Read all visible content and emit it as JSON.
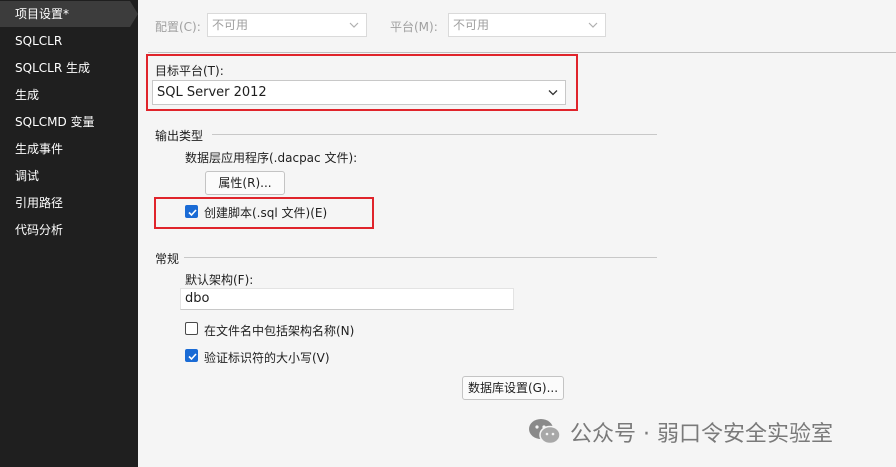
{
  "sidebar": {
    "items": [
      {
        "label": "项目设置*",
        "active": true
      },
      {
        "label": "SQLCLR"
      },
      {
        "label": "SQLCLR 生成"
      },
      {
        "label": "生成"
      },
      {
        "label": "SQLCMD 变量"
      },
      {
        "label": "生成事件"
      },
      {
        "label": "调试"
      },
      {
        "label": "引用路径"
      },
      {
        "label": "代码分析"
      }
    ]
  },
  "top": {
    "config_label": "配置(C):",
    "config_value": "不可用",
    "platform_label": "平台(M):",
    "platform_value": "不可用"
  },
  "target": {
    "label": "目标平台(T):",
    "value": "SQL Server 2012"
  },
  "output": {
    "section": "输出类型",
    "dacpac_label": "数据层应用程序(.dacpac 文件):",
    "properties_button": "属性(R)...",
    "create_script_label": "创建脚本(.sql 文件)(E)",
    "create_script_checked": true
  },
  "general": {
    "section": "常规",
    "schema_label": "默认架构(F):",
    "schema_value": "dbo",
    "include_schema_label": "在文件名中包括架构名称(N)",
    "include_schema_checked": false,
    "validate_case_label": "验证标识符的大小写(V)",
    "validate_case_checked": true,
    "db_settings_button": "数据库设置(G)..."
  },
  "watermark": {
    "text": "公众号 · 弱口令安全实验室"
  },
  "colors": {
    "sidebar_bg": "#1f1f1f",
    "sidebar_active": "#3c3c3c",
    "highlight_red": "#e0242b",
    "checkbox_blue": "#1a6bd5",
    "page_bg": "#f5f5f5"
  }
}
